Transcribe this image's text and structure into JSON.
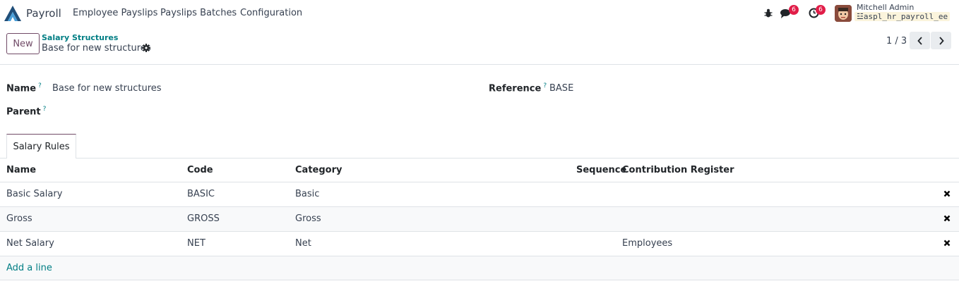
{
  "navbar": {
    "app_name": "Payroll",
    "menu": [
      "Employee Payslips",
      "Payslips Batches",
      "Configuration"
    ],
    "messages_count": "6",
    "activities_count": "6",
    "user_name": "Mitchell Admin",
    "database": "aspl_hr_payroll_ee"
  },
  "control": {
    "new_label": "New",
    "breadcrumb_parent": "Salary Structures",
    "breadcrumb_current": "Base for new structures",
    "pager": "1 / 3"
  },
  "form": {
    "name_label": "Name",
    "name_value": "Base for new structures",
    "reference_label": "Reference",
    "reference_value": "BASE",
    "parent_label": "Parent",
    "help_mark": "?"
  },
  "tabs": [
    "Salary Rules"
  ],
  "table": {
    "columns": [
      "Name",
      "Code",
      "Category",
      "Sequence",
      "Contribution Register"
    ],
    "rows": [
      {
        "name": "Basic Salary",
        "code": "BASIC",
        "category": "Basic",
        "sequence": "",
        "register": ""
      },
      {
        "name": "Gross",
        "code": "GROSS",
        "category": "Gross",
        "sequence": "",
        "register": ""
      },
      {
        "name": "Net Salary",
        "code": "NET",
        "category": "Net",
        "sequence": "",
        "register": "Employees"
      }
    ],
    "add_line": "Add a line"
  },
  "colors": {
    "brand": "#714b67",
    "link": "#017e84",
    "badge": "#e11d48"
  }
}
